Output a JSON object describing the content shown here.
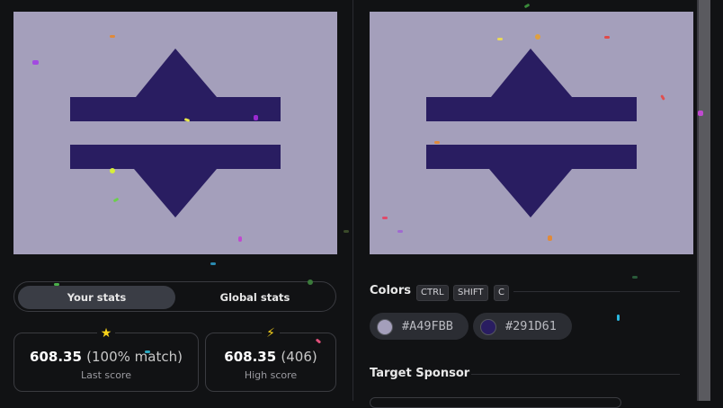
{
  "canvases": {
    "target_bg": "#A49FBB",
    "shape_color": "#291D61"
  },
  "stats": {
    "tabs": {
      "your_stats": "Your stats",
      "global_stats": "Global stats"
    },
    "last": {
      "icon": "star-icon",
      "glyph": "★",
      "value": "608.35",
      "detail": "(100% match)",
      "label": "Last score"
    },
    "high": {
      "icon": "lightning-icon",
      "glyph": "⚡",
      "value": "608.35",
      "detail": "(406)",
      "label": "High score"
    }
  },
  "colors_section": {
    "title": "Colors",
    "shortcut": [
      "CTRL",
      "SHIFT",
      "C"
    ],
    "swatches": [
      {
        "hex": "#A49FBB",
        "color": "#A49FBB"
      },
      {
        "hex": "#291D61",
        "color": "#291D61"
      }
    ]
  },
  "sponsor_section": {
    "title": "Target Sponsor"
  }
}
